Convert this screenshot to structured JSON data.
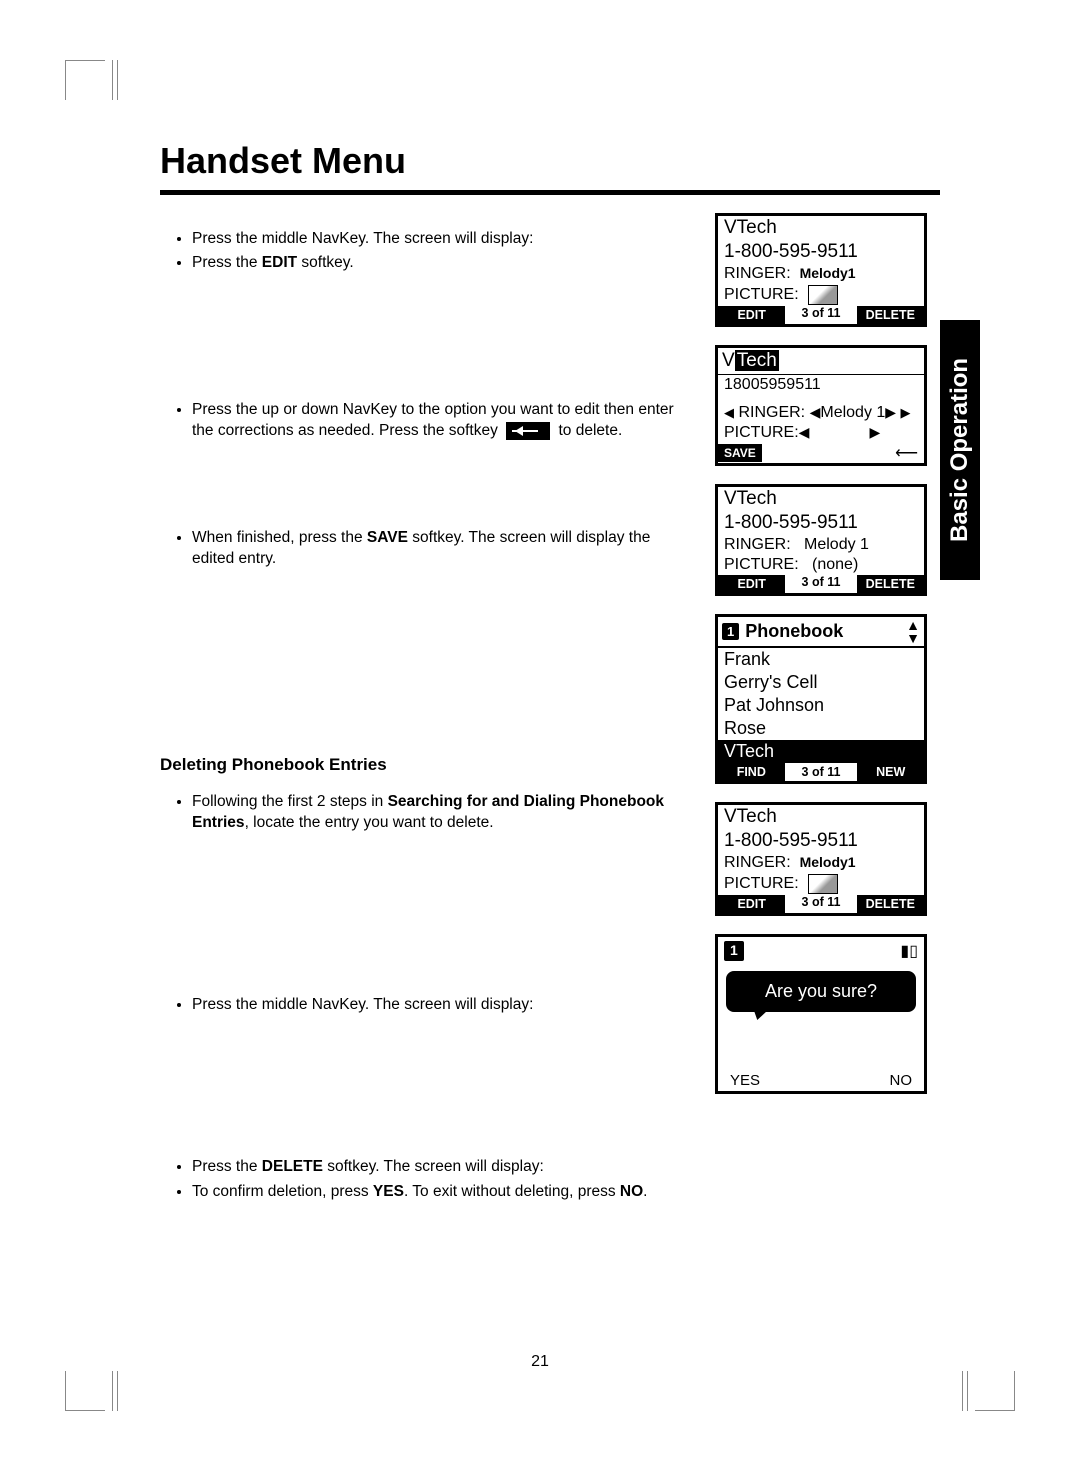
{
  "page": {
    "title": "Handset Menu",
    "number": "21",
    "side_tab": "Basic Operation"
  },
  "instructions": {
    "i1": "Press the middle NavKey. The screen will display:",
    "i2_a": "Press the ",
    "i2_b": "EDIT",
    "i2_c": " softkey.",
    "i3_a": "Press the up or down NavKey to the option you want to edit then enter the corrections as needed. Press the softkey ",
    "i3_b": " to delete.",
    "i4_a": "When finished, press the ",
    "i4_b": "SAVE",
    "i4_c": " softkey. The screen will display the edited entry.",
    "subhead": "Deleting Phonebook Entries",
    "i5_a": "Following the first 2 steps in ",
    "i5_b": "Searching for and Dialing Phonebook Entries",
    "i5_c": ", locate the entry you want to delete.",
    "i6": "Press the middle NavKey. The screen will display:",
    "i7_a": "Press the ",
    "i7_b": "DELETE",
    "i7_c": " softkey. The screen will display:",
    "i8_a": "To confirm deletion, press ",
    "i8_b": "YES",
    "i8_c": ". To exit without deleting, press ",
    "i8_d": "NO",
    "i8_e": "."
  },
  "screen1": {
    "name": "VTech",
    "number": "1-800-595-9511",
    "ringer_label": "RINGER:",
    "ringer_value": "Melody1",
    "picture_label": "PICTURE:",
    "left_btn": "EDIT",
    "mid": "3 of 11",
    "right_btn": "DELETE"
  },
  "screen2": {
    "name_v": "V",
    "name_rest": "Tech",
    "number": "18005959511",
    "ringer_label": "RINGER:",
    "ringer_value": "Melody 1",
    "picture_label": "PICTURE:",
    "save_btn": "SAVE"
  },
  "screen3": {
    "name": "VTech",
    "number": "1-800-595-9511",
    "ringer_label": "RINGER:",
    "ringer_value": "Melody 1",
    "picture_label": "PICTURE:",
    "picture_value": "(none)",
    "left_btn": "EDIT",
    "mid": "3 of 11",
    "right_btn": "DELETE"
  },
  "phonebook": {
    "num": "1",
    "title": "Phonebook",
    "items": [
      "Frank",
      "Gerry's  Cell",
      "Pat Johnson",
      "Rose",
      "VTech"
    ],
    "selected_index": 4,
    "left_btn": "FIND",
    "mid": "3 of 11",
    "right_btn": "NEW"
  },
  "screen5": {
    "name": "VTech",
    "number": "1-800-595-9511",
    "ringer_label": "RINGER:",
    "ringer_value": "Melody1",
    "picture_label": "PICTURE:",
    "left_btn": "EDIT",
    "mid": "3 of 11",
    "right_btn": "DELETE"
  },
  "confirm": {
    "num": "1",
    "message": "Are you sure?",
    "yes": "YES",
    "no": "NO"
  }
}
